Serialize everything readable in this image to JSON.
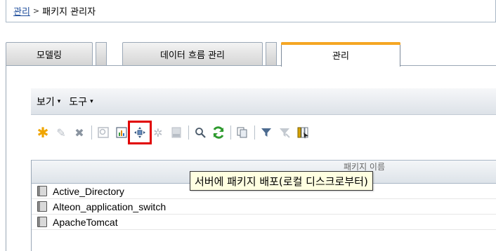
{
  "breadcrumb": {
    "link": "관리",
    "separator": ">",
    "current": "패키지 관리자"
  },
  "tabs": [
    {
      "label": "모델링",
      "active": false
    },
    {
      "label": "데이터 흐름 관리",
      "active": false
    },
    {
      "label": "관리",
      "active": true
    }
  ],
  "menubar": {
    "view": "보기",
    "tools": "도구",
    "caret": "▾"
  },
  "toolbar": {
    "icons": [
      "new-icon",
      "edit-icon",
      "delete-icon",
      "search-resources-icon",
      "export-report-icon",
      "deploy-package-icon",
      "undeploy-icon",
      "zip-icon",
      "find-icon",
      "refresh-icon",
      "copy-icon",
      "filter-icon",
      "clear-filter-icon",
      "column-chooser-icon"
    ],
    "highlighted": "deploy-package-icon"
  },
  "table": {
    "column_header": "패키지 이름",
    "rows": [
      "Active_Directory",
      "Alteon_application_switch",
      "ApacheTomcat"
    ]
  },
  "tooltip": "서버에 패키지 배포(로컬 디스크로부터)"
}
